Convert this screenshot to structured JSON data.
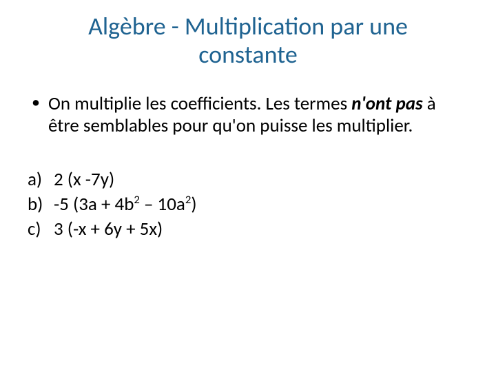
{
  "title": "Algèbre  -  Multiplication par une constante",
  "bullet": {
    "part1": "On multiplie les coefficients.  Les termes ",
    "emph": "n'ont pas",
    "part2": " à être semblables pour qu'on puisse les multiplier."
  },
  "items": [
    {
      "label": "a)",
      "pre": "2 (x -7y)"
    },
    {
      "label": "b)",
      "pre": "-5 (3a + 4b",
      "sup1": "2",
      "mid": " – 10a",
      "sup2": "2",
      "post": ")"
    },
    {
      "label": "c)",
      "pre": "3 (-x + 6y + 5x)"
    }
  ]
}
